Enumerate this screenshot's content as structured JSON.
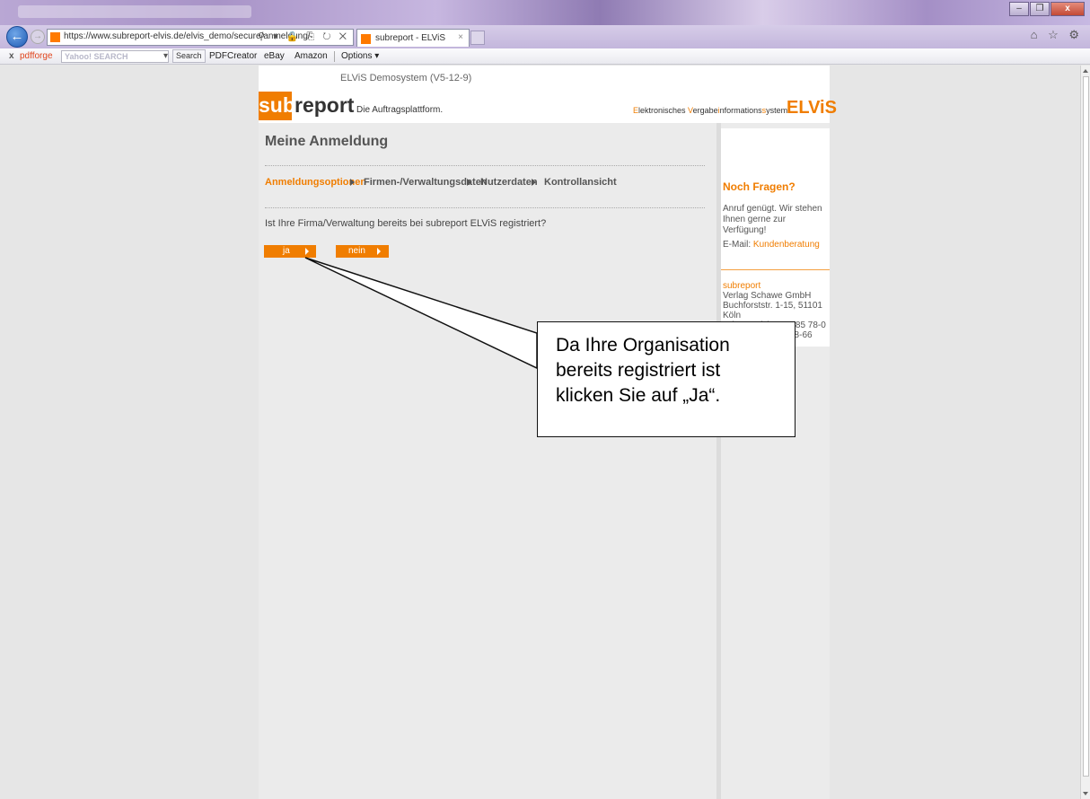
{
  "browser": {
    "url": "https://www.subreport-elvis.de/elvis_demo/secure/anmeldung/",
    "tab_title": "subreport - ELViS",
    "tab_close": "×",
    "window_buttons": {
      "minimize": "–",
      "restore": "❐",
      "close": "x"
    },
    "url_icons": "⚲ ▾ 🔒 ⎘ ↻ ✕",
    "right_icons": "⌂ ☆ ⚙"
  },
  "toolbar": {
    "close": "x",
    "pdfforge": "pdfforge",
    "search_placeholder": "Yahoo! SEARCH",
    "search_button": "Search",
    "pdfcreator": "PDFCreator",
    "ebay": "eBay",
    "amazon": "Amazon",
    "options": "Options ▾"
  },
  "page": {
    "system_title": "ELViS Demosystem (V5-12-9)",
    "logo_sub": "sub",
    "logo_report": "report",
    "tagline": "Die Auftragsplattform.",
    "elvis_long_parts": [
      "E",
      "lektronisches ",
      "V",
      "ergabe",
      "i",
      "nformations",
      "s",
      "ystem"
    ],
    "elvis_logo": "ELViS",
    "heading": "Meine Anmeldung",
    "steps": [
      "Anmeldungsoptionen",
      "Firmen-/Verwaltungsdaten",
      "Nutzerdaten",
      "Kontrollansicht"
    ],
    "question": "Ist Ihre Firma/Verwaltung bereits bei subreport ELViS registriert?",
    "btn_yes": "ja",
    "btn_no": "nein"
  },
  "sidebar": {
    "heading": "Noch Fragen?",
    "text": "Anruf genügt. Wir stehen Ihnen gerne zur Verfügung!",
    "email_label": "E-Mail: ",
    "email_link": "Kundenberatung",
    "addr_brand": "subreport",
    "addr_lines": [
      "Verlag Schawe GmbH",
      "Buchforststr. 1-15, 51101 Köln",
      "Tel.: +49 (0) 221 985 78-0",
      "78-66"
    ]
  },
  "callout": {
    "lines": [
      "Da Ihre Organisation",
      "bereits registriert ist",
      "klicken Sie auf „Ja“."
    ]
  }
}
